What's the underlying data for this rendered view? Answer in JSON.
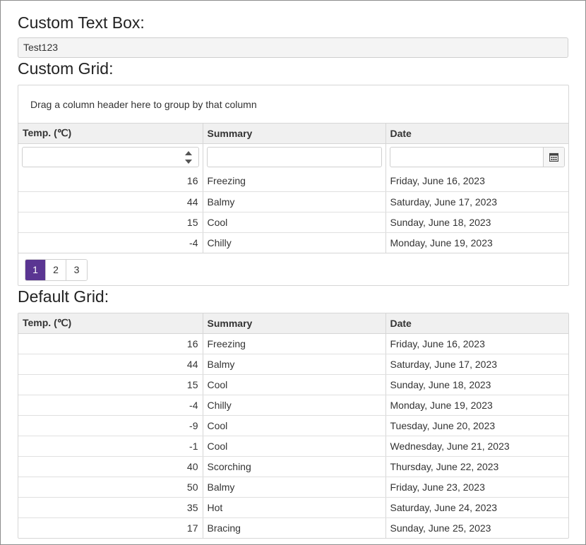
{
  "custom_text_box": {
    "title": "Custom Text Box:",
    "value": "Test123"
  },
  "custom_grid": {
    "title": "Custom Grid:",
    "group_panel_text": "Drag a column header here to group by that column",
    "columns": [
      "Temp. (℃)",
      "Summary",
      "Date"
    ],
    "rows": [
      {
        "temp": "16",
        "summary": "Freezing",
        "date": "Friday, June 16, 2023"
      },
      {
        "temp": "44",
        "summary": "Balmy",
        "date": "Saturday, June 17, 2023"
      },
      {
        "temp": "15",
        "summary": "Cool",
        "date": "Sunday, June 18, 2023"
      },
      {
        "temp": "-4",
        "summary": "Chilly",
        "date": "Monday, June 19, 2023"
      }
    ],
    "pager": {
      "pages": [
        "1",
        "2",
        "3"
      ],
      "active_page": "1"
    }
  },
  "default_grid": {
    "title": "Default Grid:",
    "columns": [
      "Temp. (℃)",
      "Summary",
      "Date"
    ],
    "rows": [
      {
        "temp": "16",
        "summary": "Freezing",
        "date": "Friday, June 16, 2023"
      },
      {
        "temp": "44",
        "summary": "Balmy",
        "date": "Saturday, June 17, 2023"
      },
      {
        "temp": "15",
        "summary": "Cool",
        "date": "Sunday, June 18, 2023"
      },
      {
        "temp": "-4",
        "summary": "Chilly",
        "date": "Monday, June 19, 2023"
      },
      {
        "temp": "-9",
        "summary": "Cool",
        "date": "Tuesday, June 20, 2023"
      },
      {
        "temp": "-1",
        "summary": "Cool",
        "date": "Wednesday, June 21, 2023"
      },
      {
        "temp": "40",
        "summary": "Scorching",
        "date": "Thursday, June 22, 2023"
      },
      {
        "temp": "50",
        "summary": "Balmy",
        "date": "Friday, June 23, 2023"
      },
      {
        "temp": "35",
        "summary": "Hot",
        "date": "Saturday, June 24, 2023"
      },
      {
        "temp": "17",
        "summary": "Bracing",
        "date": "Sunday, June 25, 2023"
      }
    ]
  },
  "icons": {
    "spinner": "numeric-spinner-icon",
    "calendar": "calendar-icon"
  },
  "colors": {
    "accent": "#5a3592",
    "header_bg": "#f0f0f0",
    "border": "#d6d6d6"
  }
}
